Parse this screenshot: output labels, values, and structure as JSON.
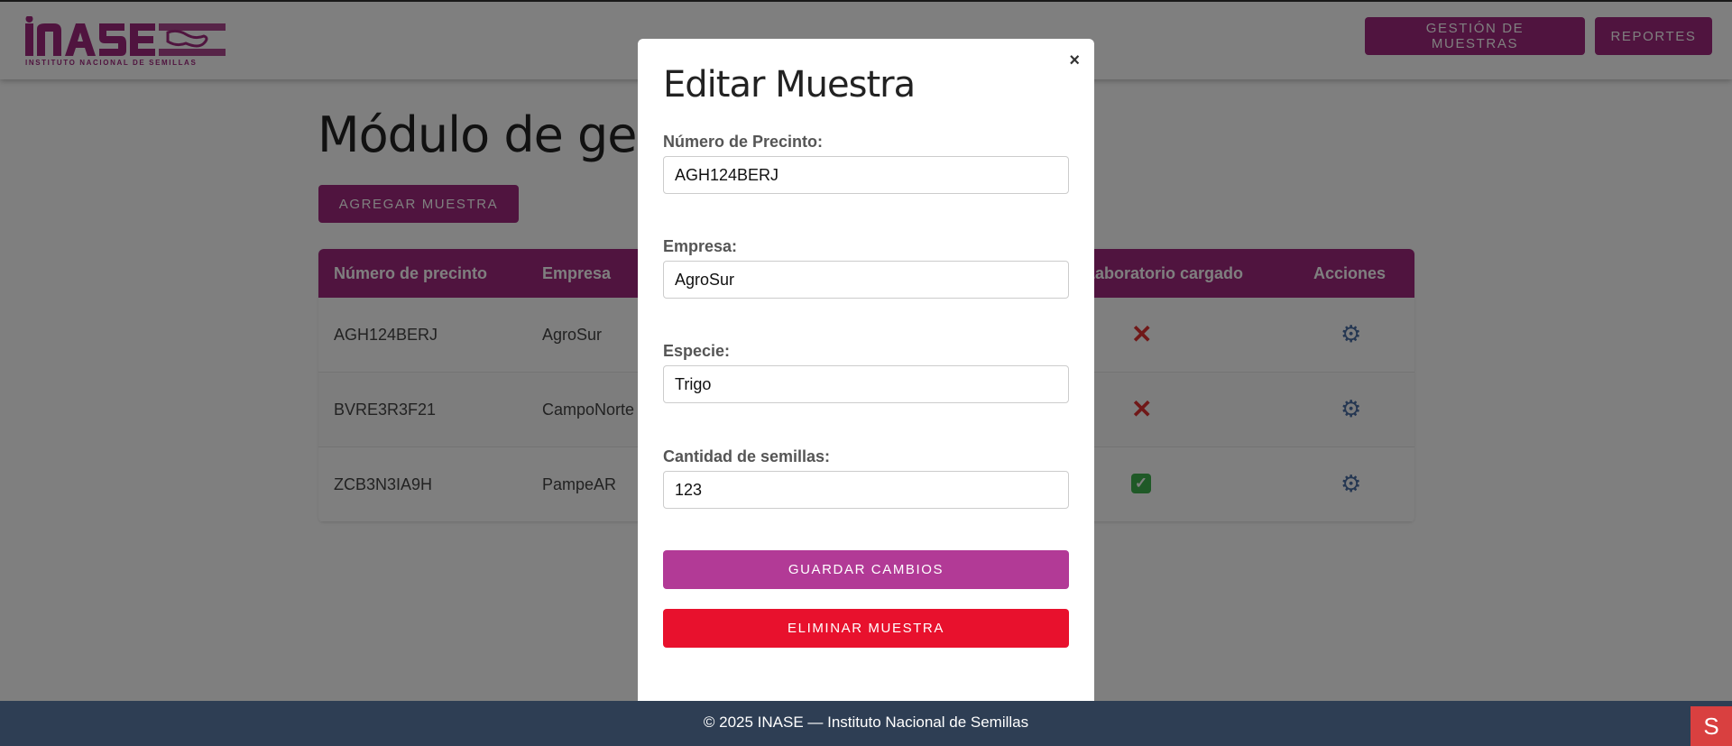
{
  "brand": {
    "logo_text": "INASE",
    "logo_subtitle": "INSTITUTO NACIONAL DE SEMILLAS",
    "color": "#a0287e"
  },
  "nav": {
    "gestion": "GESTIÓN DE MUESTRAS",
    "reportes": "REPORTES"
  },
  "page": {
    "title": "Módulo de gestión de muestras",
    "add_button": "AGREGAR MUESTRA"
  },
  "table": {
    "headers": [
      "Número de precinto",
      "Empresa",
      "Laboratorio cargado",
      "Acciones"
    ],
    "rows": [
      {
        "precinto": "AGH124BERJ",
        "empresa": "AgroSur",
        "lab_icon": "cross-icon",
        "lab_symbol": "✕",
        "action_symbol": "⚙"
      },
      {
        "precinto": "BVRE3R3F21",
        "empresa": "CampoNorte",
        "lab_icon": "cross-icon",
        "lab_symbol": "✕",
        "action_symbol": "⚙"
      },
      {
        "precinto": "ZCB3N3IA9H",
        "empresa": "PampeAR",
        "lab_icon": "check-icon",
        "lab_symbol": "✓",
        "action_symbol": "⚙"
      }
    ]
  },
  "modal": {
    "title": "Editar Muestra",
    "close": "×",
    "fields": {
      "precinto": {
        "label": "Número de Precinto:",
        "value": "AGH124BERJ"
      },
      "empresa": {
        "label": "Empresa:",
        "value": "AgroSur"
      },
      "especie": {
        "label": "Especie:",
        "value": "Trigo"
      },
      "cantidad": {
        "label": "Cantidad de semillas:",
        "value": "123"
      }
    },
    "save_button": "GUARDAR CAMBIOS",
    "delete_button": "ELIMINAR MUESTRA",
    "save_color": "#b23a96",
    "delete_color": "#e8112d"
  },
  "footer": {
    "text": "© 2025 INASE — Instituto Nacional de Semillas",
    "corner_icon": "S"
  },
  "colors": {
    "footer_bg": "#2e3e54",
    "accent": "#a0287e"
  }
}
